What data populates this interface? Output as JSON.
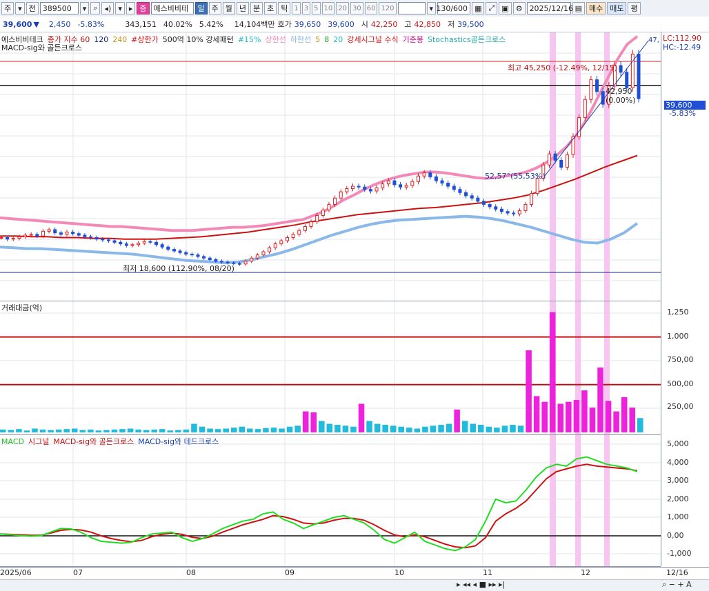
{
  "toolbar": {
    "market": "주",
    "prev": "전",
    "code": "389500",
    "name": "에스비비테",
    "jeung": "증",
    "periods": [
      "일",
      "주",
      "월",
      "년",
      "분",
      "초",
      "틱"
    ],
    "periods_selected": "일",
    "minutes": [
      "1",
      "3",
      "5",
      "10",
      "20",
      "30",
      "60",
      "120"
    ],
    "count": "130/600",
    "date": "2025/12/16",
    "buy": "매수",
    "sell": "매도",
    "eval": "평"
  },
  "quote": {
    "price": "39,600",
    "change": "2,450",
    "pct": "-5.83%",
    "volume": "343,151",
    "ratio1": "40.02%",
    "ratio2": "5.42%",
    "amount": "14,104백만",
    "ask_label": "호가",
    "ask": "39,650",
    "bid": "39,600",
    "open_label": "시",
    "open": "42,250",
    "high_label": "고",
    "high": "42,850",
    "low_label": "저",
    "low": "39,500"
  },
  "price_legend": {
    "items": [
      "에스비비테크",
      "종가 지수 60",
      "120",
      "240",
      "#상한가",
      "500억 10% 강세패턴",
      "#15%",
      "상한선",
      "하한선",
      "5",
      "8",
      "20",
      "강세시그널 수식",
      "기준봉",
      "Stochastics골든크로스"
    ],
    "line2": "MACD-sig와 골든크로스"
  },
  "price_annotations": {
    "high": "최고 45,250 (-12.49%, 12/15)",
    "low": "최저 18,600 (112.90%, 08/20)",
    "slope": "52,57°(55,53%)",
    "level": "42,950 (0.00%)",
    "lc": "LC:112.90",
    "hc": "HC:-12.49",
    "top_right": "47,",
    "current": "39,600",
    "current_pct": "-5.83%"
  },
  "volume_panel": {
    "title": "거래대금(억)",
    "ticks": [
      "1,250",
      "1,000",
      "750,00",
      "500,00",
      "250,00"
    ]
  },
  "macd_panel": {
    "legend": [
      "MACD",
      "시그널",
      "MACD-sig와 골든크로스",
      "MACD-sig와 데드크로스"
    ],
    "ticks": [
      "5,000",
      "4,000",
      "3,000",
      "2,000",
      "1,000",
      "0,00",
      "-1,000"
    ]
  },
  "date_axis": [
    "2025/06",
    "07",
    "08",
    "09",
    "10",
    "11",
    "12",
    "12/16"
  ],
  "colors": {
    "up": "#e02020",
    "down": "#1f4fd6",
    "ma5": "#22cc22",
    "ma20": "#33dddd",
    "ma60": "#cc1111",
    "ma120": "#101a7a",
    "ma240": "#d4a020",
    "upper_band": "#f28ab8",
    "lower_band": "#8ab8e8",
    "highlight": "#f6c6f0",
    "macd": "#22dd22",
    "signal": "#cc1111"
  },
  "chart_data": {
    "type": "candlestick",
    "title": "에스비비테크",
    "candles_close": [
      22000,
      21800,
      21900,
      22100,
      22300,
      22400,
      22200,
      22800,
      23000,
      22600,
      22400,
      22700,
      22500,
      22300,
      22100,
      22000,
      21800,
      21700,
      21600,
      21400,
      21200,
      21000,
      21100,
      21300,
      21500,
      21400,
      21100,
      20800,
      20500,
      20300,
      20100,
      19900,
      19800,
      19600,
      19400,
      19200,
      19000,
      18900,
      18800,
      18700,
      18650,
      19000,
      19400,
      19800,
      20200,
      20700,
      21200,
      21600,
      22000,
      22400,
      22900,
      23400,
      24000,
      24800,
      25500,
      26200,
      27000,
      27800,
      28200,
      28500,
      28400,
      28100,
      27900,
      28300,
      28800,
      29200,
      28700,
      28400,
      28600,
      29100,
      29800,
      30200,
      29700,
      29200,
      28900,
      28500,
      28100,
      27700,
      27300,
      27000,
      26600,
      26200,
      25900,
      25600,
      25300,
      25100,
      25000,
      25400,
      26200,
      27600,
      29500,
      31200,
      32600,
      31800,
      30900,
      32500,
      34800,
      37200,
      39500,
      42000,
      40500,
      38900,
      41200,
      43800,
      42950,
      41000,
      45250,
      39600
    ],
    "upper_band": [
      24500,
      24400,
      24300,
      24200,
      24100,
      24000,
      23900,
      23800,
      23700,
      23600,
      23500,
      23400,
      23400,
      23300,
      23200,
      23100,
      23000,
      22900,
      22900,
      22900,
      23000,
      23100,
      23200,
      23300,
      23300,
      23400,
      23500,
      23700,
      23900,
      24100,
      24300,
      24800,
      25300,
      26000,
      26800,
      27400,
      28100,
      28700,
      29200,
      29600,
      29900,
      30100,
      30300,
      30300,
      30200,
      30000,
      29800,
      29600,
      29500,
      29600,
      29800,
      30000,
      30300,
      30800,
      31500,
      32400,
      33500,
      35000,
      37000,
      39500,
      42000,
      44500,
      46500,
      47500
    ],
    "lower_band": [
      20800,
      20700,
      20600,
      20600,
      20500,
      20400,
      20300,
      20200,
      20100,
      20000,
      19900,
      19700,
      19500,
      19300,
      19100,
      19000,
      18900,
      18800,
      18900,
      19200,
      19600,
      20000,
      20500,
      21100,
      21700,
      22300,
      22800,
      23300,
      23700,
      24000,
      24200,
      24300,
      24400,
      24500,
      24600,
      24700,
      24600,
      24400,
      24100,
      23700,
      23300,
      22800,
      22300,
      21800,
      21400,
      21300,
      21800,
      22600,
      23800
    ],
    "ma60": [
      22200,
      22200,
      22100,
      22100,
      22000,
      22000,
      21900,
      21900,
      21800,
      21800,
      21800,
      21900,
      22000,
      22100,
      22300,
      22500,
      22700,
      23000,
      23300,
      23600,
      24000,
      24300,
      24600,
      24900,
      25100,
      25300,
      25500,
      25700,
      25800,
      26000,
      26200,
      26400,
      26700,
      27000,
      27400,
      28000,
      28700,
      29400,
      30200,
      31000,
      31700,
      32400
    ],
    "volume": [
      30,
      25,
      35,
      20,
      40,
      30,
      25,
      30,
      35,
      40,
      25,
      30,
      20,
      25,
      30,
      35,
      40,
      30,
      25,
      30,
      35,
      20,
      25,
      30,
      90,
      60,
      40,
      35,
      40,
      50,
      60,
      40,
      35,
      45,
      50,
      40,
      60,
      70,
      220,
      210,
      120,
      90,
      80,
      70,
      60,
      300,
      120,
      90,
      80,
      70,
      60,
      50,
      40,
      60,
      70,
      80,
      90,
      240,
      120,
      90,
      80,
      60,
      50,
      70,
      80,
      70,
      860,
      380,
      320,
      1260,
      300,
      320,
      340,
      440,
      260,
      680,
      330,
      220,
      370,
      260,
      150
    ],
    "volume_ticks": [
      250,
      500,
      750,
      1000,
      1250
    ],
    "volume_unit": "억",
    "macd": [
      100,
      60,
      20,
      -20,
      0,
      200,
      400,
      380,
      200,
      -100,
      -300,
      -350,
      -400,
      -350,
      -100,
      100,
      150,
      200,
      -100,
      -300,
      -150,
      100,
      400,
      600,
      800,
      900,
      1200,
      1300,
      900,
      700,
      400,
      600,
      800,
      1000,
      1100,
      900,
      700,
      300,
      -200,
      -400,
      -100,
      200,
      -300,
      -500,
      -700,
      -800,
      -600,
      -200,
      800,
      2000,
      1800,
      1900,
      2500,
      3200,
      3700,
      3900,
      3800,
      4200,
      4300,
      4100,
      3900,
      3800,
      3700,
      3500
    ],
    "signal": [
      100,
      80,
      60,
      30,
      30,
      150,
      300,
      350,
      320,
      200,
      0,
      -150,
      -250,
      -320,
      -250,
      -50,
      80,
      150,
      80,
      -80,
      -150,
      -20,
      200,
      400,
      600,
      750,
      900,
      1100,
      1050,
      900,
      700,
      650,
      700,
      850,
      950,
      950,
      850,
      600,
      300,
      50,
      -50,
      50,
      -50,
      -250,
      -450,
      -600,
      -650,
      -550,
      -100,
      800,
      1200,
      1500,
      1900,
      2500,
      3100,
      3500,
      3650,
      3800,
      3900,
      3800,
      3750,
      3700,
      3650,
      3550
    ],
    "macd_ticks": [
      -1000,
      0,
      1000,
      2000,
      3000,
      4000,
      5000
    ]
  }
}
